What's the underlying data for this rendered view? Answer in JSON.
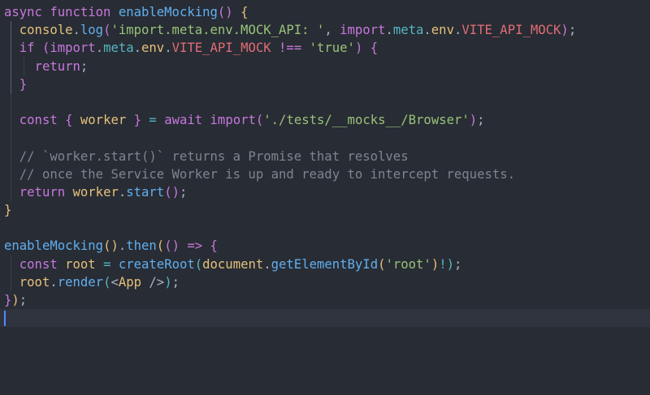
{
  "editor": {
    "language": "javascript",
    "lines": [
      [
        {
          "t": "async",
          "c": "kw"
        },
        {
          "t": " "
        },
        {
          "t": "function",
          "c": "kw"
        },
        {
          "t": " "
        },
        {
          "t": "enableMocking",
          "c": "fn"
        },
        {
          "t": "()",
          "c": "br2"
        },
        {
          "t": " "
        },
        {
          "t": "{",
          "c": "br1"
        }
      ],
      [
        {
          "t": "  "
        },
        {
          "t": "console",
          "c": "var"
        },
        {
          "t": ".",
          "c": "pun"
        },
        {
          "t": "log",
          "c": "fn"
        },
        {
          "t": "(",
          "c": "br2"
        },
        {
          "t": "'import.meta.env.MOCK_API: '",
          "c": "str"
        },
        {
          "t": ", ",
          "c": "pun"
        },
        {
          "t": "import",
          "c": "kw"
        },
        {
          "t": ".",
          "c": "pun"
        },
        {
          "t": "meta",
          "c": "prop"
        },
        {
          "t": ".",
          "c": "pun"
        },
        {
          "t": "env",
          "c": "var"
        },
        {
          "t": ".",
          "c": "pun"
        },
        {
          "t": "VITE_API_MOCK",
          "c": "cst"
        },
        {
          "t": ")",
          "c": "br2"
        },
        {
          "t": ";",
          "c": "pun"
        }
      ],
      [
        {
          "t": "  "
        },
        {
          "t": "if",
          "c": "kw"
        },
        {
          "t": " "
        },
        {
          "t": "(",
          "c": "br2"
        },
        {
          "t": "import",
          "c": "kw"
        },
        {
          "t": ".",
          "c": "pun"
        },
        {
          "t": "meta",
          "c": "prop"
        },
        {
          "t": ".",
          "c": "pun"
        },
        {
          "t": "env",
          "c": "var"
        },
        {
          "t": ".",
          "c": "pun"
        },
        {
          "t": "VITE_API_MOCK",
          "c": "cst"
        },
        {
          "t": " "
        },
        {
          "t": "!==",
          "c": "kw"
        },
        {
          "t": " "
        },
        {
          "t": "'true'",
          "c": "str"
        },
        {
          "t": ")",
          "c": "br2"
        },
        {
          "t": " "
        },
        {
          "t": "{",
          "c": "br2"
        }
      ],
      [
        {
          "t": "    "
        },
        {
          "t": "return",
          "c": "kw"
        },
        {
          "t": ";",
          "c": "pun"
        }
      ],
      [
        {
          "t": "  "
        },
        {
          "t": "}",
          "c": "br2"
        }
      ],
      [],
      [
        {
          "t": "  "
        },
        {
          "t": "const",
          "c": "kw"
        },
        {
          "t": " "
        },
        {
          "t": "{",
          "c": "br2"
        },
        {
          "t": " "
        },
        {
          "t": "worker",
          "c": "var"
        },
        {
          "t": " "
        },
        {
          "t": "}",
          "c": "br2"
        },
        {
          "t": " "
        },
        {
          "t": "=",
          "c": "prop"
        },
        {
          "t": " "
        },
        {
          "t": "await",
          "c": "kw"
        },
        {
          "t": " "
        },
        {
          "t": "import",
          "c": "kw"
        },
        {
          "t": "(",
          "c": "br2"
        },
        {
          "t": "'./tests/__mocks__/Browser'",
          "c": "str"
        },
        {
          "t": ")",
          "c": "br2"
        },
        {
          "t": ";",
          "c": "pun"
        }
      ],
      [],
      [
        {
          "t": "  "
        },
        {
          "t": "// `worker.start()` returns a Promise that resolves",
          "c": "com"
        }
      ],
      [
        {
          "t": "  "
        },
        {
          "t": "// once the Service Worker is up and ready to intercept requests.",
          "c": "com"
        }
      ],
      [
        {
          "t": "  "
        },
        {
          "t": "return",
          "c": "kw"
        },
        {
          "t": " "
        },
        {
          "t": "worker",
          "c": "var"
        },
        {
          "t": ".",
          "c": "pun"
        },
        {
          "t": "start",
          "c": "fn"
        },
        {
          "t": "()",
          "c": "br2"
        },
        {
          "t": ";",
          "c": "pun"
        }
      ],
      [
        {
          "t": "}",
          "c": "br1"
        }
      ],
      [],
      [
        {
          "t": "enableMocking",
          "c": "fn"
        },
        {
          "t": "()",
          "c": "br1"
        },
        {
          "t": ".",
          "c": "pun"
        },
        {
          "t": "then",
          "c": "fn"
        },
        {
          "t": "(",
          "c": "br1"
        },
        {
          "t": "()",
          "c": "br2"
        },
        {
          "t": " "
        },
        {
          "t": "=>",
          "c": "kw"
        },
        {
          "t": " "
        },
        {
          "t": "{",
          "c": "br2"
        }
      ],
      [
        {
          "t": "  "
        },
        {
          "t": "const",
          "c": "kw"
        },
        {
          "t": " "
        },
        {
          "t": "root",
          "c": "var"
        },
        {
          "t": " "
        },
        {
          "t": "=",
          "c": "prop"
        },
        {
          "t": " "
        },
        {
          "t": "createRoot",
          "c": "fn"
        },
        {
          "t": "(",
          "c": "br3"
        },
        {
          "t": "document",
          "c": "var"
        },
        {
          "t": ".",
          "c": "pun"
        },
        {
          "t": "getElementById",
          "c": "fn"
        },
        {
          "t": "(",
          "c": "br1"
        },
        {
          "t": "'root'",
          "c": "str"
        },
        {
          "t": ")",
          "c": "br1"
        },
        {
          "t": "!",
          "c": "prop"
        },
        {
          "t": ")",
          "c": "br3"
        },
        {
          "t": ";",
          "c": "pun"
        }
      ],
      [
        {
          "t": "  "
        },
        {
          "t": "root",
          "c": "var"
        },
        {
          "t": ".",
          "c": "pun"
        },
        {
          "t": "render",
          "c": "fn"
        },
        {
          "t": "(",
          "c": "br3"
        },
        {
          "t": "<",
          "c": "pl"
        },
        {
          "t": "App",
          "c": "var"
        },
        {
          "t": " />",
          "c": "pl"
        },
        {
          "t": ")",
          "c": "br3"
        },
        {
          "t": ";",
          "c": "pun"
        }
      ],
      [
        {
          "t": "}",
          "c": "br2"
        },
        {
          "t": ")",
          "c": "br1"
        },
        {
          "t": ";",
          "c": "pun"
        }
      ],
      []
    ],
    "current_line": 18
  }
}
